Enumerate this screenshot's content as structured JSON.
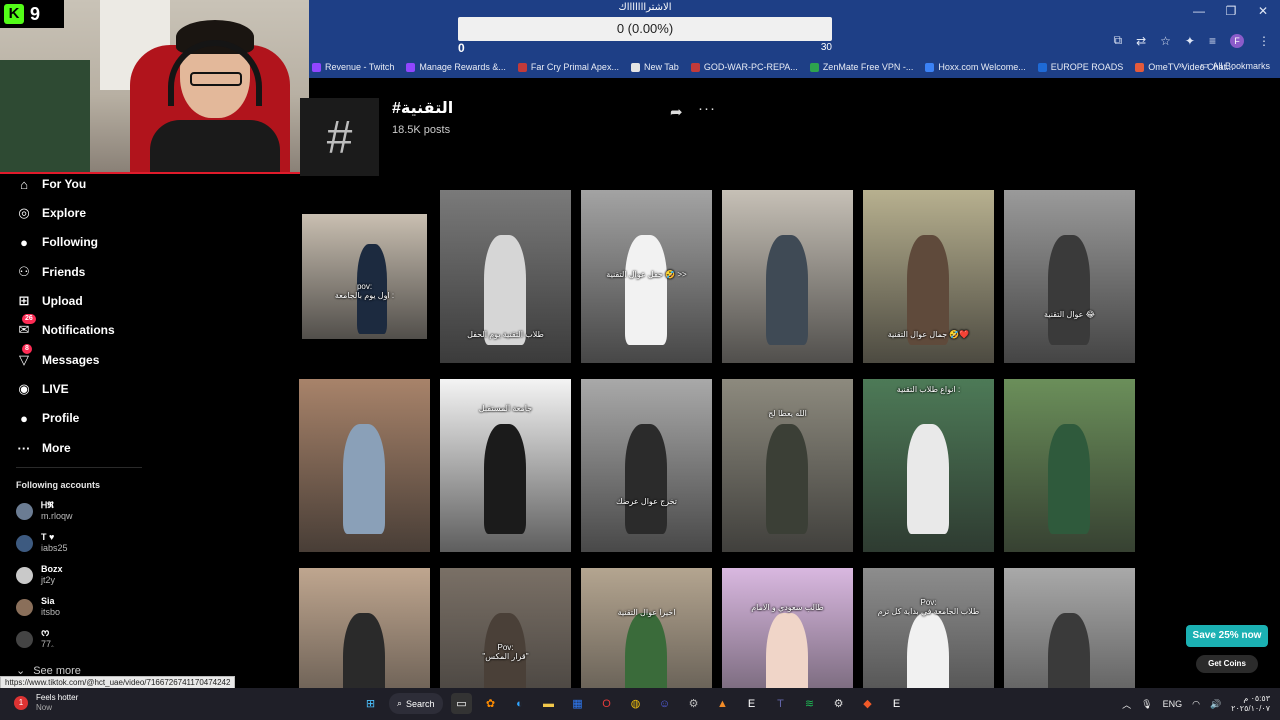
{
  "window": {
    "controls": [
      "—",
      "❐",
      "✕"
    ]
  },
  "overlay": {
    "title": "الاشتراااااااك",
    "progress_text": "0 (0.00%)",
    "min": "0",
    "max": "30"
  },
  "bookmarks": [
    {
      "label": "Revenue - Twitch",
      "color": "#9146ff"
    },
    {
      "label": "Manage Rewards &...",
      "color": "#9146ff"
    },
    {
      "label": "Far Cry Primal Apex...",
      "color": "#c23a3a"
    },
    {
      "label": "New Tab",
      "color": "#e5e5e5"
    },
    {
      "label": "GOD-WAR-PC-REPA...",
      "color": "#c23a3a"
    },
    {
      "label": "ZenMate Free VPN -...",
      "color": "#2da44e"
    },
    {
      "label": "Hoxx.com Welcome...",
      "color": "#3b82f6"
    },
    {
      "label": "EUROPE ROADS",
      "color": "#1e6ad6"
    },
    {
      "label": "OmeTV Video Chat...",
      "color": "#e45a3b"
    }
  ],
  "bookmarks_more": "»",
  "all_bookmarks": "All Bookmarks",
  "webcam": {
    "kick_count": "9"
  },
  "sidebar": {
    "items": [
      {
        "label": "For You",
        "icon": "home-icon",
        "glyph": "⌂"
      },
      {
        "label": "Explore",
        "icon": "compass-icon",
        "glyph": "◎"
      },
      {
        "label": "Following",
        "icon": "following-icon",
        "glyph": "●"
      },
      {
        "label": "Friends",
        "icon": "friends-icon",
        "glyph": "⚇"
      },
      {
        "label": "Upload",
        "icon": "upload-icon",
        "glyph": "⊞"
      },
      {
        "label": "Notifications",
        "icon": "inbox-icon",
        "glyph": "✉",
        "badge": "26"
      },
      {
        "label": "Messages",
        "icon": "messages-icon",
        "glyph": "▽",
        "badge": "8"
      },
      {
        "label": "LIVE",
        "icon": "live-icon",
        "glyph": "◉"
      },
      {
        "label": "Profile",
        "icon": "profile-icon",
        "glyph": "●"
      },
      {
        "label": "More",
        "icon": "more-icon",
        "glyph": "···"
      }
    ],
    "following_header": "Following accounts",
    "accounts": [
      {
        "name": "Ꮋ𝕽",
        "handle": "m.rloqw",
        "color": "#6b7c93"
      },
      {
        "name": "T ♥",
        "handle": "iabs25",
        "color": "#3d5a80"
      },
      {
        "name": "Bozx",
        "handle": "jt2y",
        "color": "#c9c9c9"
      },
      {
        "name": "Sia",
        "handle": "itsbo",
        "color": "#8a6f5a"
      },
      {
        "name": "ᰔ",
        "handle": "ۦ77",
        "color": "#444"
      }
    ],
    "see_more": "See more"
  },
  "hashtag": {
    "title": "#التقنية",
    "posts": "18.5K posts"
  },
  "tiles": [
    {
      "bg": "#c9bfb1",
      "fig": "#1c2a3f",
      "cap": "pov:\nاول يوم بالجامعة :",
      "capTop": 90
    },
    {
      "bg": "#7a7a7a",
      "fig": "#d6d6d6",
      "cap": "طلاب التقنية يوم الحفل",
      "capTop": 140
    },
    {
      "bg": "#a3a3a3",
      "fig": "#f2f2f2",
      "cap": "حفل عوال التقنية 🤣 >>",
      "capTop": 80
    },
    {
      "bg": "#c6c0b6",
      "fig": "#3f4a55",
      "cap": "",
      "capTop": 140
    },
    {
      "bg": "#b7b08f",
      "fig": "#5f4a3b",
      "cap": "جمال عوال التقنية 🤣❤️",
      "capTop": 140
    },
    {
      "bg": "#9a9a9a",
      "fig": "#3a3a3a",
      "cap": "عوال التقنية 😂",
      "capTop": 120
    },
    {
      "bg": "#a8836a",
      "fig": "#8aa0b8",
      "cap": "",
      "capTop": 140
    },
    {
      "bg": "#f4f4f4",
      "fig": "#1b1b1b",
      "cap": "جامعة المستقبل",
      "capTop": 25
    },
    {
      "bg": "#a9a9a9",
      "fig": "#2b2b2b",
      "cap": "تخرج عوال عرضك",
      "capTop": 118
    },
    {
      "bg": "#8d8a7e",
      "fig": "#3b3f36",
      "cap": "الله يعطا لج",
      "capTop": 30
    },
    {
      "bg": "#4d7a57",
      "fig": "#e9e9e9",
      "cap": "انواع طلاب التقنية :",
      "capTop": 6
    },
    {
      "bg": "#6b8f5a",
      "fig": "#2f5a3c",
      "cap": "",
      "capTop": 140
    },
    {
      "bg": "#bfa68f",
      "fig": "#2a2a2a",
      "cap": "",
      "capTop": 140
    },
    {
      "bg": "#7a7066",
      "fig": "#4a4038",
      "cap": "Pov:\n\"قرار المكس\"",
      "capTop": 75
    },
    {
      "bg": "#b4a590",
      "fig": "#3a6b3a",
      "cap": "اخيرا عوال التقنية",
      "capTop": 40
    },
    {
      "bg": "#d9b8e0",
      "fig": "#f0d5c8",
      "cap": "طالب سعودي و الامام",
      "capTop": 35
    },
    {
      "bg": "#8d8d8d",
      "fig": "#f1f1f1",
      "cap": "Pov:\nطلاب الجامعة في بداية كل ترم",
      "capTop": 30
    },
    {
      "bg": "#a9a9a9",
      "fig": "#3a3a3a",
      "cap": "",
      "capTop": 140
    }
  ],
  "status_url": "https://www.tiktok.com/@hct_uae/video/7166726741170474242",
  "promo": {
    "save": "Save 25% now",
    "coins": "Get Coins"
  },
  "taskbar": {
    "notif_title": "Feels hotter",
    "notif_sub": "Now",
    "search": "Search",
    "lang": "ENG",
    "time": "٠٥:٥٣ م",
    "date": "٢٠٢٥/١٠/٠٧"
  }
}
